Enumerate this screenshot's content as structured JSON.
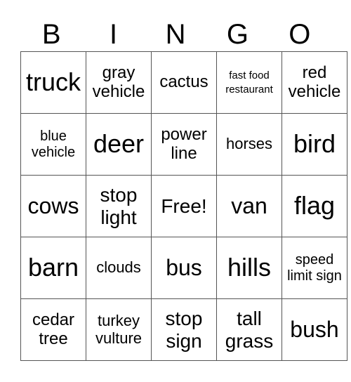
{
  "header": [
    "B",
    "I",
    "N",
    "G",
    "O"
  ],
  "grid": [
    [
      "truck",
      "gray vehicle",
      "cactus",
      "fast food restaurant",
      "red vehicle"
    ],
    [
      "blue vehicle",
      "deer",
      "power line",
      "horses",
      "bird"
    ],
    [
      "cows",
      "stop light",
      "Free!",
      "van",
      "flag"
    ],
    [
      "barn",
      "clouds",
      "bus",
      "hills",
      "speed limit sign"
    ],
    [
      "cedar tree",
      "turkey vulture",
      "stop sign",
      "tall grass",
      "bush"
    ]
  ]
}
